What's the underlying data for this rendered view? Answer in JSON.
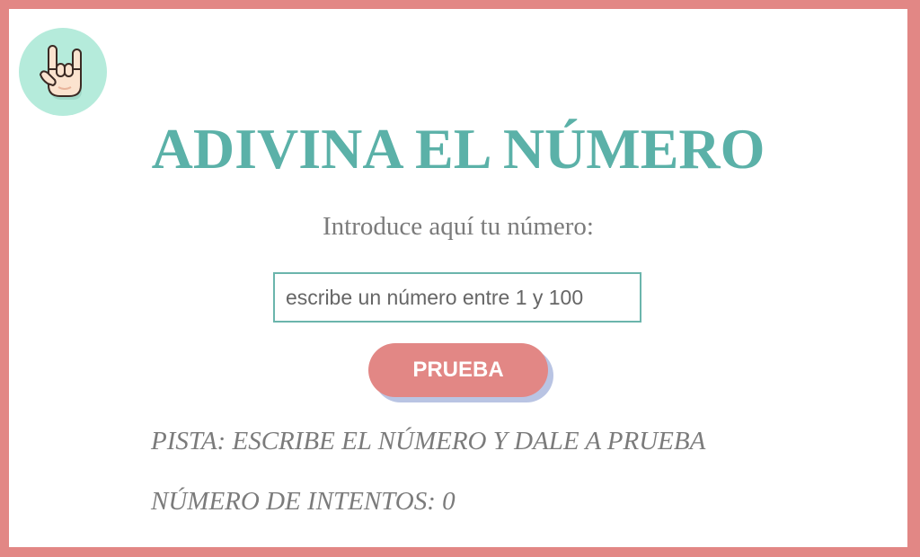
{
  "game": {
    "title": "ADIVINA EL NÚMERO",
    "prompt": "Introduce aquí tu número:",
    "input_placeholder": "escribe un número entre 1 y 100",
    "input_value": "",
    "button_label": "PRUEBA",
    "hint_label": "PISTA:",
    "hint_text": "ESCRIBE EL NÚMERO Y DALE A PRUEBA",
    "attempts_label": "NÚMERO DE INTENTOS:",
    "attempts_count": "0"
  },
  "logo": {
    "icon": "rock-hand-icon"
  },
  "colors": {
    "frame": "#e28785",
    "background": "#ffffff",
    "title": "#5bb1a8",
    "text": "#7b7b7b",
    "input_border": "#6bb5ac",
    "button": "#e28785",
    "button_shadow": "#b9c4e3",
    "logo_circle": "#b5ebdb"
  }
}
